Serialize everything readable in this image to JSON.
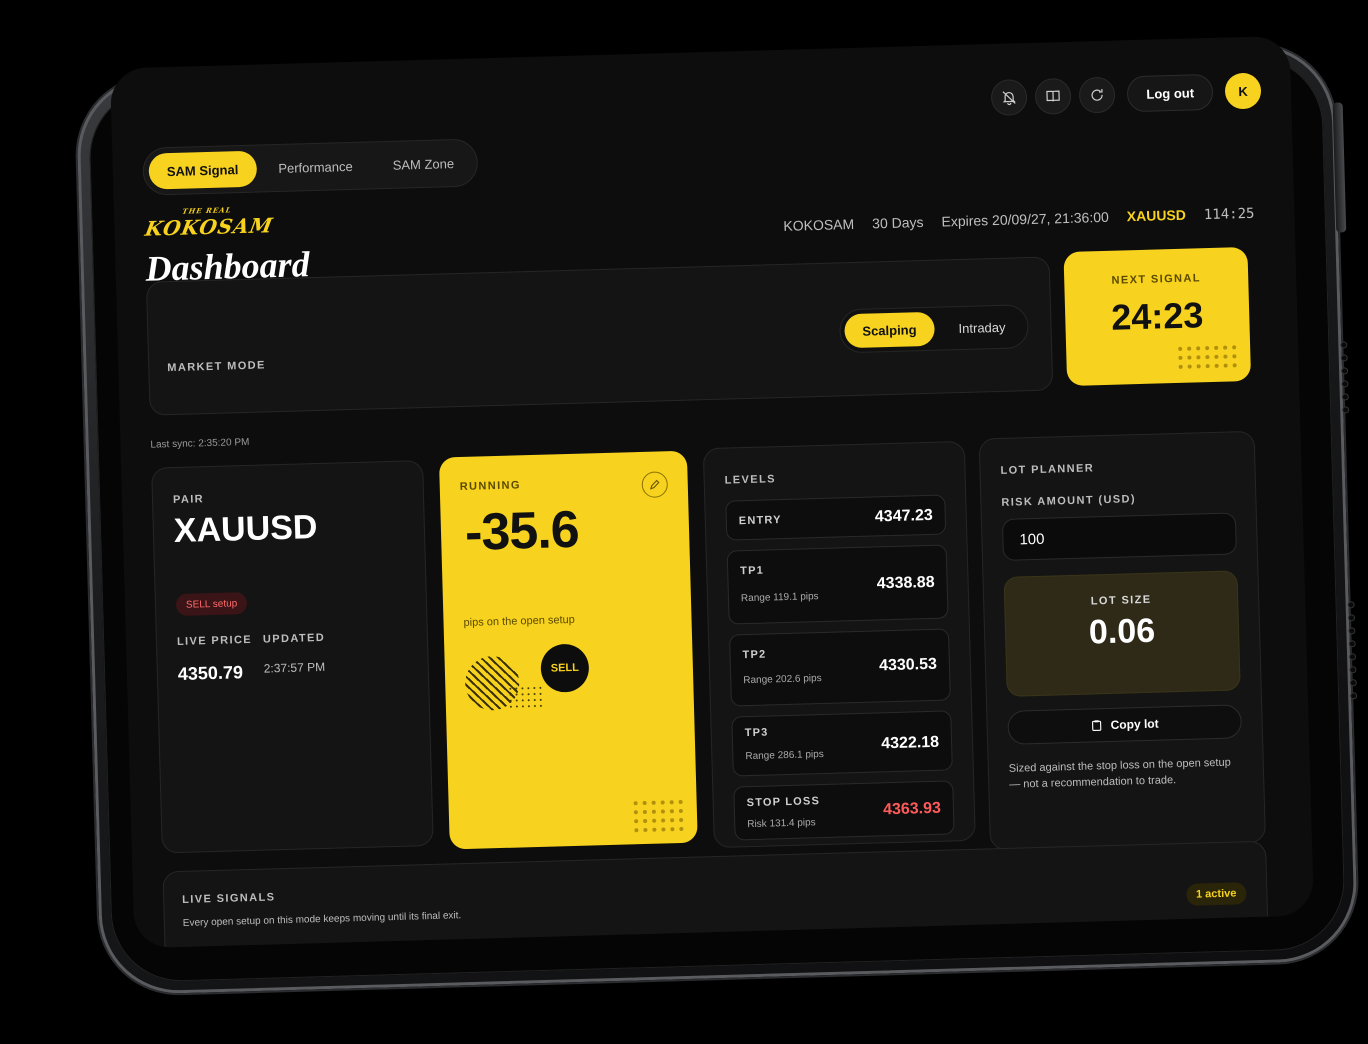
{
  "nav": {
    "tabs": [
      {
        "label": "SAM Signal",
        "active": true
      },
      {
        "label": "Performance",
        "active": false
      },
      {
        "label": "SAM Zone",
        "active": false
      }
    ]
  },
  "top_actions": {
    "icons": [
      "bell-off-icon",
      "book-icon",
      "refresh-icon"
    ],
    "logout_label": "Log out",
    "avatar_initial": "K"
  },
  "brand": {
    "tagline": "THE REAL",
    "name": "KOKOSAM"
  },
  "page_title": "Dashboard",
  "meta": {
    "user": "KOKOSAM",
    "plan": "30 Days",
    "expires": "Expires 20/09/27, 21:36:00",
    "pair": "XAUUSD",
    "clock": "114:25"
  },
  "market_mode": {
    "label": "MARKET MODE",
    "options": [
      "Scalping",
      "Intraday"
    ],
    "selected": "Scalping"
  },
  "next_signal": {
    "label": "NEXT SIGNAL",
    "value": "24:23"
  },
  "last_sync": "Last sync: 2:35:20 PM",
  "pair_card": {
    "label": "PAIR",
    "pair": "XAUUSD",
    "badge": "SELL setup",
    "live_price_label": "LIVE PRICE",
    "updated_label": "UPDATED",
    "live_price": "4350.79",
    "updated": "2:37:57 PM"
  },
  "running": {
    "label": "RUNNING",
    "value": "-35.6",
    "caption": "pips on the open setup",
    "action": "SELL"
  },
  "levels": {
    "label": "LEVELS",
    "rows": [
      {
        "name": "ENTRY",
        "sub": "",
        "value": "4347.23"
      },
      {
        "name": "TP1",
        "sub": "Range 119.1 pips",
        "value": "4338.88"
      },
      {
        "name": "TP2",
        "sub": "Range 202.6 pips",
        "value": "4330.53"
      },
      {
        "name": "TP3",
        "sub": "Range 286.1 pips",
        "value": "4322.18"
      },
      {
        "name": "STOP LOSS",
        "sub": "Risk 131.4 pips",
        "value": "4363.93"
      }
    ]
  },
  "lot_planner": {
    "label": "LOT PLANNER",
    "risk_label": "RISK AMOUNT (USD)",
    "risk_value": "100",
    "lot_size_label": "LOT SIZE",
    "lot_size": "0.06",
    "copy_label": "Copy lot",
    "note": "Sized against the stop loss on the open setup — not a recommendation to trade."
  },
  "live_signals": {
    "label": "LIVE SIGNALS",
    "sub": "Every open setup on this mode keeps moving until its final exit.",
    "count": "1 active"
  },
  "colors": {
    "accent": "#f7d21e",
    "background": "#0d0d0d",
    "danger": "#ff5a5a"
  }
}
